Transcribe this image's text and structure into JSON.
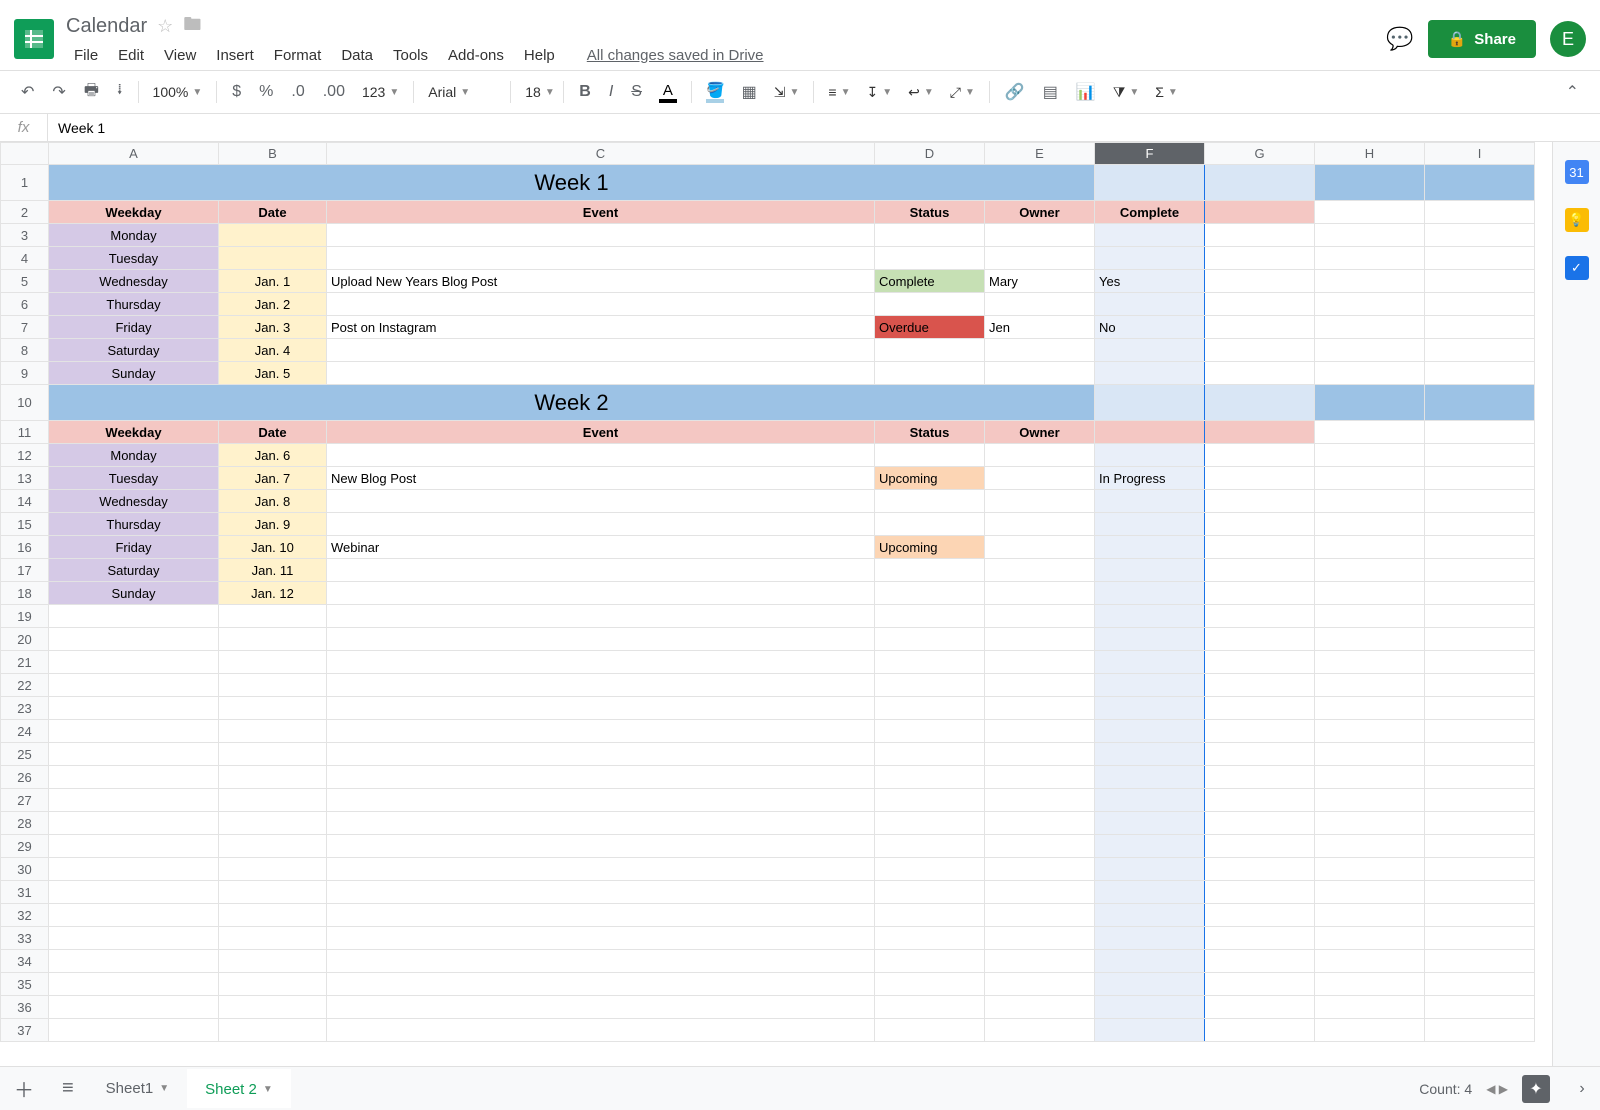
{
  "doc": {
    "title": "Calendar",
    "save_status": "All changes saved in Drive"
  },
  "menubar": [
    "File",
    "Edit",
    "View",
    "Insert",
    "Format",
    "Data",
    "Tools",
    "Add-ons",
    "Help"
  ],
  "share_label": "Share",
  "avatar_letter": "E",
  "toolbar": {
    "zoom": "100%",
    "font_name": "Arial",
    "font_size": "18",
    "number_format": "123"
  },
  "fx_value": "Week 1",
  "columns": [
    "A",
    "B",
    "C",
    "D",
    "E",
    "F",
    "G",
    "H",
    "I"
  ],
  "selected_col": "F",
  "headers": {
    "weekday": "Weekday",
    "date": "Date",
    "event": "Event",
    "status": "Status",
    "owner": "Owner",
    "complete": "Complete"
  },
  "weeks": [
    {
      "title": "Week 1",
      "row": 1,
      "header_row": 2,
      "show_complete": true,
      "days": [
        {
          "weekday": "Monday",
          "date": "",
          "event": "",
          "status": "",
          "owner": "",
          "complete": ""
        },
        {
          "weekday": "Tuesday",
          "date": "",
          "event": "",
          "status": "",
          "owner": "",
          "complete": ""
        },
        {
          "weekday": "Wednesday",
          "date": "Jan. 1",
          "event": "Upload New Years Blog Post",
          "status": "Complete",
          "status_class": "complete",
          "owner": "Mary",
          "complete": "Yes"
        },
        {
          "weekday": "Thursday",
          "date": "Jan. 2",
          "event": "",
          "status": "",
          "owner": "",
          "complete": ""
        },
        {
          "weekday": "Friday",
          "date": "Jan. 3",
          "event": "Post on Instagram",
          "status": "Overdue",
          "status_class": "overdue",
          "owner": "Jen",
          "complete": "No"
        },
        {
          "weekday": "Saturday",
          "date": "Jan. 4",
          "event": "",
          "status": "",
          "owner": "",
          "complete": ""
        },
        {
          "weekday": "Sunday",
          "date": "Jan. 5",
          "event": "",
          "status": "",
          "owner": "",
          "complete": ""
        }
      ]
    },
    {
      "title": "Week 2",
      "row": 10,
      "header_row": 11,
      "show_complete": false,
      "days": [
        {
          "weekday": "Monday",
          "date": "Jan. 6",
          "event": "",
          "status": "",
          "owner": "",
          "complete": ""
        },
        {
          "weekday": "Tuesday",
          "date": "Jan. 7",
          "event": "New Blog Post",
          "status": "Upcoming",
          "status_class": "upcoming",
          "owner": "",
          "complete": "In Progress"
        },
        {
          "weekday": "Wednesday",
          "date": "Jan. 8",
          "event": "",
          "status": "",
          "owner": "",
          "complete": ""
        },
        {
          "weekday": "Thursday",
          "date": "Jan. 9",
          "event": "",
          "status": "",
          "owner": "",
          "complete": ""
        },
        {
          "weekday": "Friday",
          "date": "Jan. 10",
          "event": "Webinar",
          "status": "Upcoming",
          "status_class": "upcoming",
          "owner": "",
          "complete": ""
        },
        {
          "weekday": "Saturday",
          "date": "Jan. 11",
          "event": "",
          "status": "",
          "owner": "",
          "complete": ""
        },
        {
          "weekday": "Sunday",
          "date": "Jan. 12",
          "event": "",
          "status": "",
          "owner": "",
          "complete": ""
        }
      ]
    }
  ],
  "sheets": {
    "tabs": [
      {
        "name": "Sheet1",
        "active": false
      },
      {
        "name": "Sheet 2",
        "active": true
      }
    ],
    "count_label": "Count: 4"
  },
  "side_icons": [
    "31",
    "💡",
    "✓"
  ]
}
